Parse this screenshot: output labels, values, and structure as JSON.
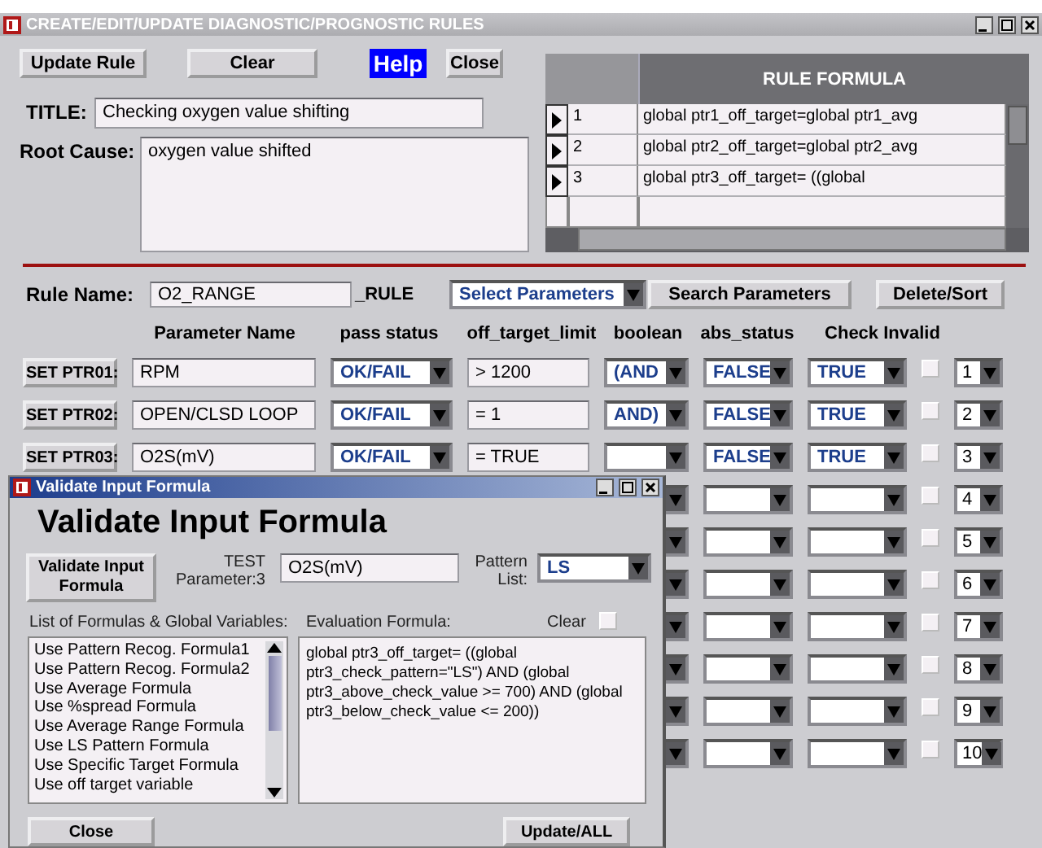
{
  "window": {
    "title": "CREATE/EDIT/UPDATE DIAGNOSTIC/PROGNOSTIC RULES"
  },
  "toolbar": [
    {
      "label": "Update Rule",
      "kind": "plain"
    },
    {
      "label": "Clear",
      "kind": "plain"
    },
    {
      "label": "Help",
      "kind": "highlight"
    },
    {
      "label": "Close",
      "kind": "plain"
    }
  ],
  "title_field": {
    "label": "TITLE:",
    "value": "Checking oxygen value shifting"
  },
  "root_cause": {
    "label": "Root Cause:",
    "value": "oxygen value shifted"
  },
  "formula_table": {
    "header": "RULE FORMULA",
    "rows": [
      {
        "number": "1",
        "formula": "global ptr1_off_target=global ptr1_avg"
      },
      {
        "number": "2",
        "formula": "global ptr2_off_target=global ptr2_avg"
      },
      {
        "number": "3",
        "formula": "global ptr3_off_target= ((global"
      }
    ]
  },
  "rule_name": {
    "label": "Rule Name:",
    "value": "O2_RANGE",
    "suffix": "_RULE"
  },
  "parameter_select": {
    "value": "Select Parameters"
  },
  "buttons": [
    "Search Parameters",
    "Delete/Sort"
  ],
  "columns": [
    "Parameter Name",
    "pass status",
    "off_target_limit",
    "boolean",
    "abs_status",
    "Check Invalid"
  ],
  "rows": [
    {
      "button": "SET PTR01:",
      "name": "RPM",
      "pass_status": "OK/FAIL",
      "limit": "> 1200",
      "boolean": "(AND",
      "abs_status": "FALSE",
      "check_invalid": "TRUE",
      "checked": false,
      "order": "1"
    },
    {
      "button": "SET PTR02:",
      "name": "OPEN/CLSD LOOP",
      "pass_status": "OK/FAIL",
      "limit": "= 1",
      "boolean": "AND)",
      "abs_status": "FALSE",
      "check_invalid": "TRUE",
      "checked": false,
      "order": "2"
    },
    {
      "button": "SET PTR03:",
      "name": "O2S(mV)",
      "pass_status": "OK/FAIL",
      "limit": "= TRUE",
      "abs_status": "FALSE",
      "check_invalid": "TRUE",
      "checked": false,
      "order": "3"
    },
    {
      "checked": false,
      "order": "4"
    },
    {
      "checked": false,
      "order": "5"
    },
    {
      "checked": false,
      "order": "6"
    },
    {
      "checked": false,
      "order": "7"
    },
    {
      "checked": false,
      "order": "8"
    },
    {
      "checked": false,
      "order": "9"
    },
    {
      "checked": false,
      "order": "10"
    }
  ],
  "dialog": {
    "title": "Validate Input Formula",
    "heading": "Validate Input Formula",
    "validate_button": "Validate Input Formula",
    "test_label": "TEST Parameter:3",
    "test_value": "O2S(mV)",
    "pattern_label": "Pattern List:",
    "pattern_value": "LS",
    "list_label": "List of Formulas & Global Variables:",
    "list_items": [
      "Use Pattern Recog. Formula1",
      "Use Pattern Recog. Formula2",
      "Use Average Formula",
      "Use %spread Formula",
      "Use Average Range Formula",
      "Use LS Pattern Formula",
      "Use Specific Target Formula",
      "Use off target variable"
    ],
    "eval_label": "Evaluation Formula:",
    "clear_label": "Clear",
    "clear_checked": false,
    "eval_text": "global ptr3_off_target= ((global ptr3_check_pattern=\"LS\") AND (global ptr3_above_check_value >= 700) AND (global ptr3_below_check_value <= 200))",
    "buttons": [
      "Close",
      "Update/ALL"
    ]
  }
}
